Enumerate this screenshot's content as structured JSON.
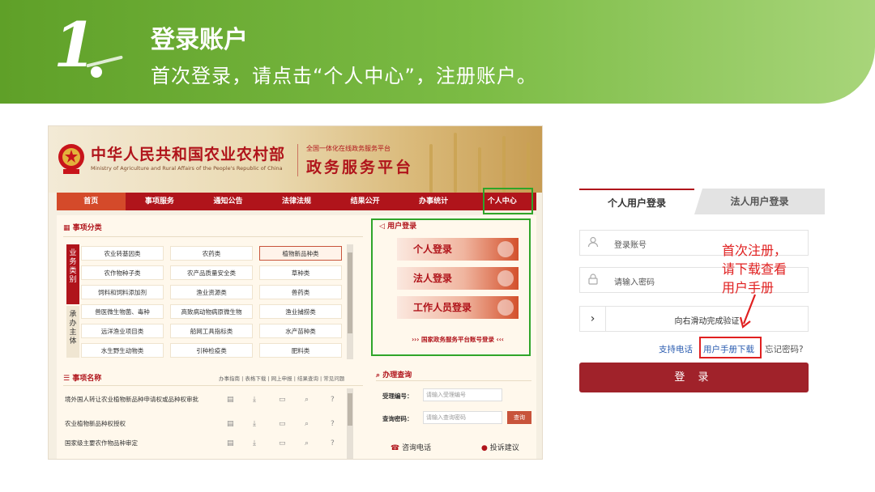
{
  "slide": {
    "step_number": "1",
    "title": "登录账户",
    "subtitle": "首次登录，请点击“个人中心”，注册账户。",
    "accent_color": "#6aab35"
  },
  "portal": {
    "ministry_name": "中华人民共和国农业农村部",
    "ministry_en": "Ministry of Agriculture and Rural Affairs of the People's Republic of China",
    "portal_tag": "全国一体化在线政务服务平台",
    "portal_name": "政务服务平台",
    "nav": [
      "首页",
      "事项服务",
      "通知公告",
      "法律法规",
      "结果公开",
      "办事统计",
      "个人中心"
    ],
    "category_title": "事项分类",
    "category_groups": [
      "业务类别",
      "承办主体"
    ],
    "categories": [
      "农业转基因类",
      "农药类",
      "植物新品种类",
      "农作物种子类",
      "农产品质量安全类",
      "草种类",
      "饲料和饲料添加剂",
      "渔业资源类",
      "兽药类",
      "兽医微生物菌、毒种",
      "高致病动物病原微生物",
      "渔业捕捞类",
      "远洋渔业项目类",
      "船网工具指标类",
      "水产苗种类",
      "水生野生动物类",
      "引种检疫类",
      "肥料类"
    ],
    "matter_title": "事项名称",
    "matter_links": "办事指南 | 表格下载 | 网上申报 | 结果查询 | 常见问题",
    "matters": [
      "境外国人转让农业植物新品种申请权或品种权审批",
      "农业植物新品种权授权",
      "国家级主要农作物品种审定"
    ],
    "login": {
      "title": "用户登录",
      "buttons": [
        "个人登录",
        "法人登录",
        "工作人员登录"
      ],
      "gov_login": "国家政务服务平台账号登录"
    },
    "query": {
      "title": "办理查询",
      "number_label": "受理编号：",
      "number_placeholder": "请输入受理编号",
      "password_label": "查询密码：",
      "password_placeholder": "请输入查询密码",
      "button": "查询",
      "hotline": "咨询电话",
      "complaint": "投诉建议"
    }
  },
  "login_form": {
    "tab_personal": "个人用户登录",
    "tab_legal": "法人用户登录",
    "account_placeholder": "登录账号",
    "password_placeholder": "请输入密码",
    "slider_text": "向右滑动完成验证",
    "support_link": "支持电话",
    "manual_link": "用户手册下载",
    "forgot_link": "忘记密码?",
    "submit": "登 录",
    "submit_color": "#a0222a"
  },
  "callout": {
    "lines": [
      "首次注册，",
      "请下载查看",
      "用户手册"
    ],
    "color": "#e02020"
  },
  "icons": {
    "user": "user-icon",
    "lock": "lock-icon",
    "chevron": "chevron-right-icon",
    "grid": "grid-icon",
    "speaker": "speaker-icon",
    "search": "search-icon",
    "phone": "phone-icon"
  }
}
